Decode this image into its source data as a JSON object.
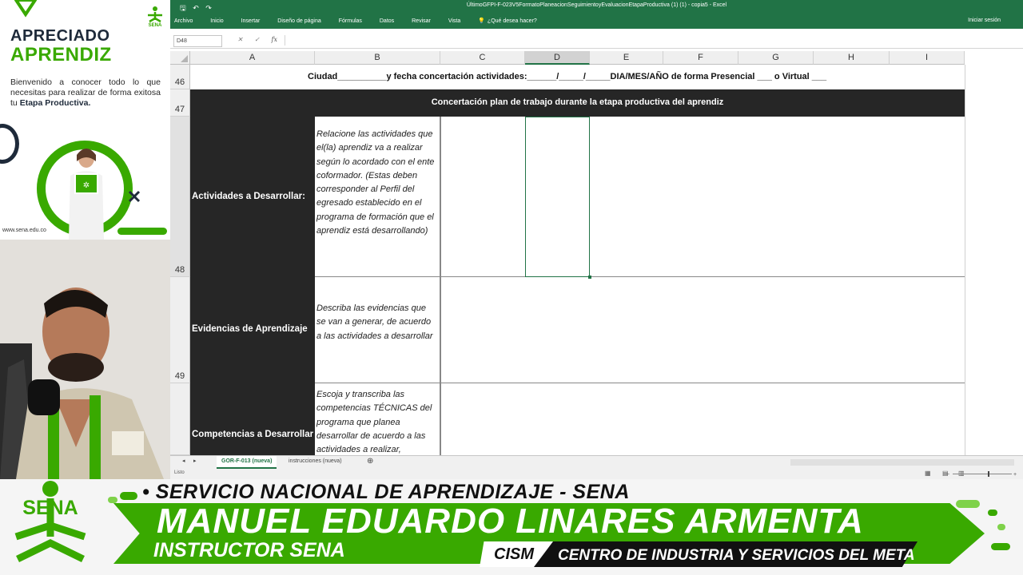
{
  "left_panel": {
    "title_line1": "APRECIADO",
    "title_line2": "APRENDIZ",
    "intro_text": "Bienvenido a conocer todo lo que necesitas para realizar de forma exitosa tu",
    "intro_highlight": "Etapa Productiva.",
    "website": "www.sena.edu.co",
    "brand_color": "#39a900"
  },
  "excel": {
    "window_title": "ÚltimoGFPI-F-023V5FormatoPlaneacionSeguimientoyEvaluacionEtapaProductiva (1) (1) - copia5 - Excel",
    "ribbon_tabs": [
      "Archivo",
      "Inicio",
      "Insertar",
      "Diseño de página",
      "Fórmulas",
      "Datos",
      "Revisar",
      "Vista"
    ],
    "tell_me": "¿Qué desea hacer?",
    "sign_in": "Iniciar sesión",
    "name_box": "D48",
    "fx_label": "fx",
    "columns": [
      "A",
      "B",
      "C",
      "D",
      "E",
      "F",
      "G",
      "H",
      "I"
    ],
    "selected_column": "D",
    "rows": [
      "46",
      "47",
      "48",
      "49",
      ""
    ],
    "row46_text": "Ciudad__________y fecha concertación actividades:______/_____/_____DIA/MES/AÑO  de forma Presencial ___  o Virtual ___",
    "row47_header": "Concertación plan de trabajo durante la etapa productiva del aprendiz",
    "sections": [
      {
        "label": "Actividades a Desarrollar:",
        "description": "Relacione las actividades que el(la) aprendiz va a realizar según lo acordado con el ente coformador. (Estas deben corresponder al Perfil del egresado establecido en el programa de formación que el aprendiz está desarrollando)"
      },
      {
        "label": "Evidencias de Aprendizaje",
        "description": "Describa las evidencias que se van a generar, de acuerdo a las actividades a desarrollar"
      },
      {
        "label": "Competencias a Desarrollar",
        "description": "Escoja  y transcriba las competencias  TÉCNICAS del programa  que planea desarrollar de  acuerdo a las actividades a realizar,"
      }
    ],
    "sheet_tabs": [
      "GOR-F-013 (nueva)",
      "instrucciones (nueva)"
    ],
    "active_sheet": "GOR-F-013 (nueva)",
    "status": "Listo",
    "accent_color": "#217346"
  },
  "banner": {
    "org_line": "SERVICIO NACIONAL DE APRENDIZAJE - SENA",
    "presenter_name": "MANUEL EDUARDO LINARES ARMENTA",
    "presenter_role": "INSTRUCTOR SENA",
    "center_code": "CISM",
    "center_name": "CENTRO DE INDUSTRIA Y SERVICIOS DEL META",
    "logo_text": "SENA"
  }
}
